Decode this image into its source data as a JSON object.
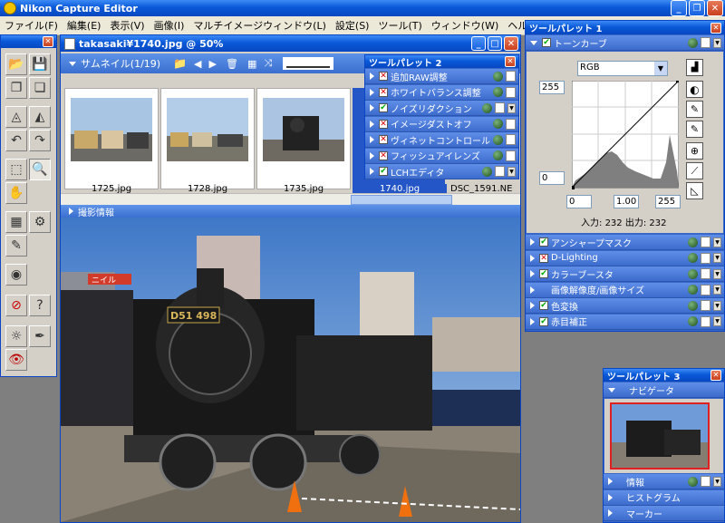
{
  "app": {
    "title": "Nikon Capture Editor"
  },
  "menu": [
    "ファイル(F)",
    "編集(E)",
    "表示(V)",
    "画像(I)",
    "マルチイメージウィンドウ(L)",
    "設定(S)",
    "ツール(T)",
    "ウィンドウ(W)",
    "ヘルプ(H)"
  ],
  "document": {
    "title": "takasaki¥1740.jpg @ 50%",
    "thumbnail_label": "サムネイル(1/19)",
    "thumbnails": [
      "1725.jpg",
      "1728.jpg",
      "1735.jpg",
      "1740.jpg",
      "DSC_1591.NE"
    ],
    "shooting_info_label": "撮影情報",
    "plate_text": "D51 498",
    "sign_text": "ニイル"
  },
  "palette1": {
    "title": "ツールパレット 1",
    "tone_curve": {
      "label": "トーンカーブ",
      "channel": "RGB",
      "output_max": "255",
      "output_min": "0",
      "input_black": "0",
      "gamma": "1.00",
      "input_white": "255",
      "input_label": "入力:",
      "input_value": "232",
      "output_label": "出力:",
      "output_value": "232"
    },
    "items": [
      {
        "label": "アンシャープマスク",
        "check": "on"
      },
      {
        "label": "D-Lighting",
        "check": "x"
      },
      {
        "label": "カラーブースタ",
        "check": "on"
      },
      {
        "label": "画像解像度/画像サイズ",
        "check": "none"
      },
      {
        "label": "色変換",
        "check": "on"
      },
      {
        "label": "赤目補正",
        "check": "on"
      }
    ]
  },
  "palette2": {
    "title": "ツールパレット 2",
    "items": [
      {
        "label": "追加RAW調整",
        "check": "x"
      },
      {
        "label": "ホワイトバランス調整",
        "check": "x"
      },
      {
        "label": "ノイズリダクション",
        "check": "on"
      },
      {
        "label": "イメージダストオフ",
        "check": "x"
      },
      {
        "label": "ヴィネットコントロール",
        "check": "x"
      },
      {
        "label": "フィッシュアイレンズ",
        "check": "x"
      },
      {
        "label": "LCHエディタ",
        "check": "on"
      }
    ]
  },
  "palette3": {
    "title": "ツールパレット 3",
    "items": [
      "ナビゲータ",
      "情報",
      "ヒストグラム",
      "マーカー"
    ]
  },
  "colors": {
    "titlebar": "#0a59d8",
    "palette_row": "#3d6ccd",
    "check_green": "#00aa00",
    "check_red": "#dd0000"
  }
}
